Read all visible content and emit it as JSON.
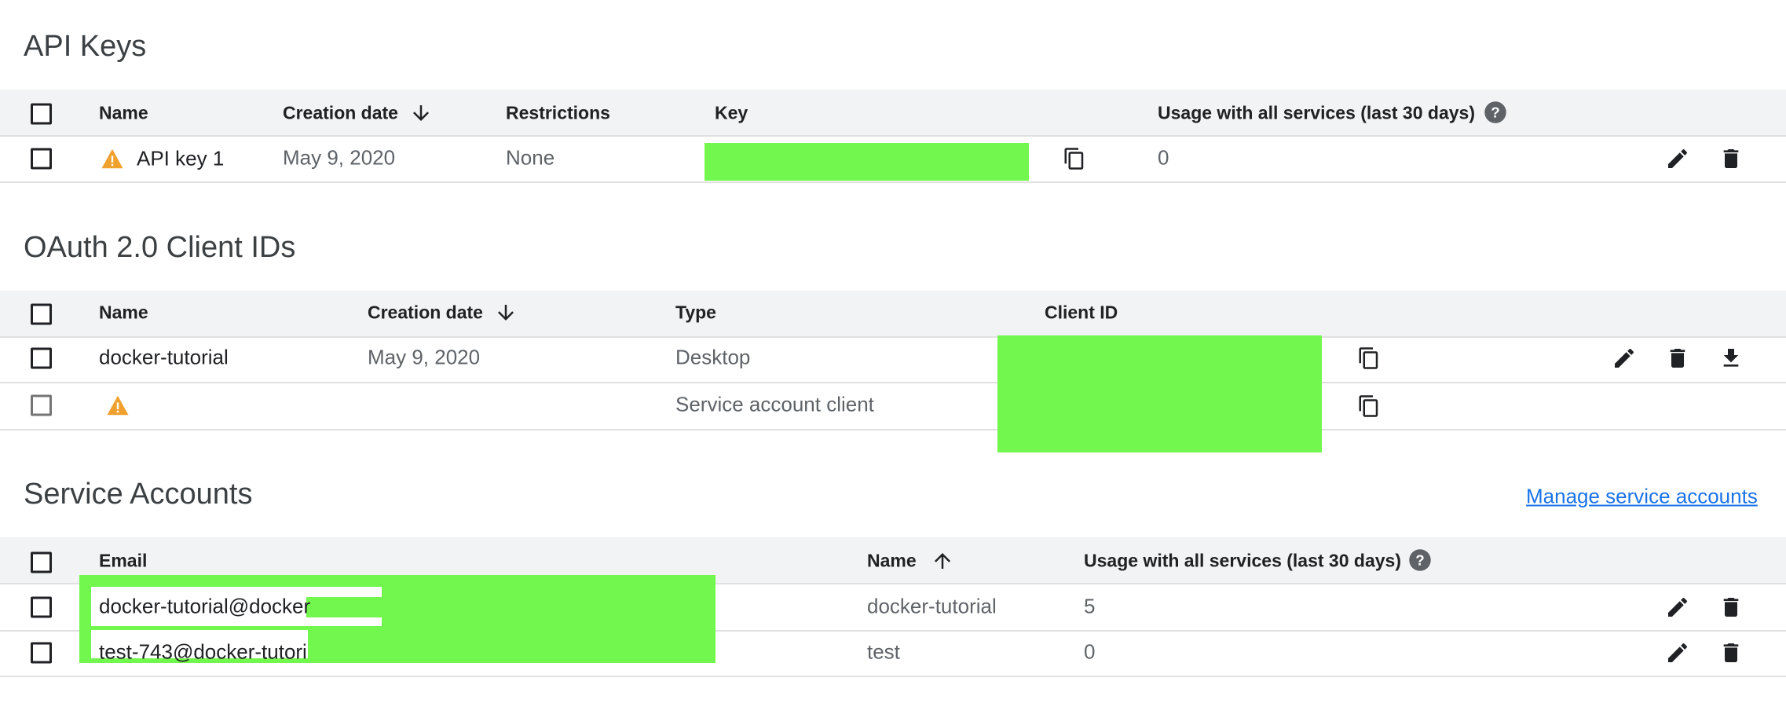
{
  "api_keys": {
    "title": "API Keys",
    "columns": {
      "name": "Name",
      "creation_date": "Creation date",
      "restrictions": "Restrictions",
      "key": "Key",
      "usage": "Usage with all services (last 30 days)"
    },
    "rows": [
      {
        "name": "API key 1",
        "creation_date": "May 9, 2020",
        "restrictions": "None",
        "usage": "0"
      }
    ]
  },
  "oauth": {
    "title": "OAuth 2.0 Client IDs",
    "columns": {
      "name": "Name",
      "creation_date": "Creation date",
      "type": "Type",
      "client_id": "Client ID"
    },
    "rows": [
      {
        "name": "docker-tutorial",
        "creation_date": "May 9, 2020",
        "type": "Desktop"
      },
      {
        "name": "",
        "creation_date": "",
        "type": "Service account client"
      }
    ]
  },
  "service_accounts": {
    "title": "Service Accounts",
    "manage_link": "Manage service accounts",
    "columns": {
      "email": "Email",
      "name": "Name",
      "usage": "Usage with all services (last 30 days)"
    },
    "rows": [
      {
        "email": "docker-tutorial@docker",
        "name": "docker-tutorial",
        "usage": "5"
      },
      {
        "email": "test-743@docker-tutori",
        "name": "test",
        "usage": "0"
      }
    ]
  },
  "icons": {
    "warning": "warning-icon",
    "copy": "copy-icon",
    "edit": "pencil-icon",
    "delete": "trash-icon",
    "download": "download-icon",
    "help": "help-icon",
    "sort_down": "arrow-down-icon",
    "sort_up": "arrow-up-icon"
  },
  "colors": {
    "redaction": "#72f74e",
    "warning": "#f0a02d",
    "link": "#1a73e8",
    "header_bg": "#f1f3f4"
  }
}
